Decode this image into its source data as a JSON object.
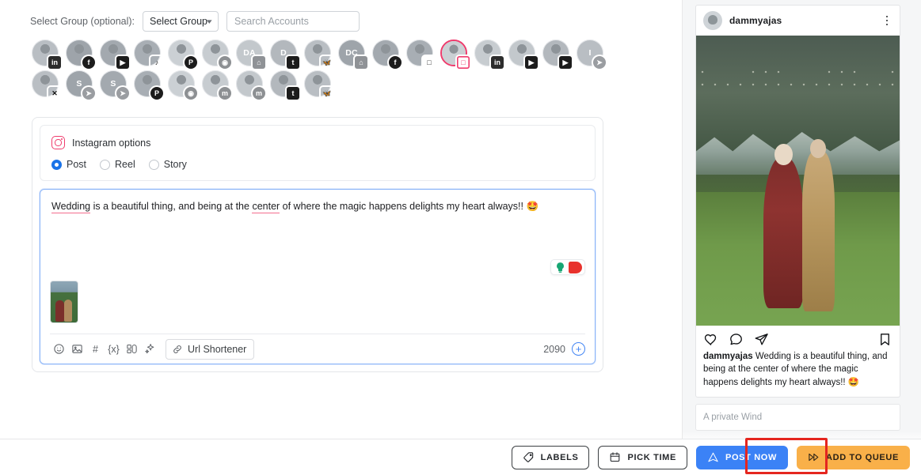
{
  "composer": {
    "group_label": "Select Group (optional):",
    "group_select_value": "Select Group",
    "group_chevron": "chevron-down-icon",
    "search_placeholder": "Search Accounts"
  },
  "accounts": {
    "row1": [
      {
        "initials": "",
        "network": "linkedin",
        "selected": false
      },
      {
        "initials": "",
        "network": "facebook",
        "selected": false
      },
      {
        "initials": "",
        "network": "youtube",
        "selected": false
      },
      {
        "initials": "",
        "network": "tiktok",
        "selected": false
      },
      {
        "initials": "",
        "network": "pinterest",
        "selected": false
      },
      {
        "initials": "",
        "network": "reddit",
        "selected": false
      },
      {
        "initials": "DA",
        "network": "google-business",
        "selected": false
      },
      {
        "initials": "D",
        "network": "tumblr",
        "selected": false
      },
      {
        "initials": "",
        "network": "bluesky",
        "selected": false
      },
      {
        "initials": "DC",
        "network": "google-business",
        "selected": false
      },
      {
        "initials": "",
        "network": "facebook",
        "selected": false
      },
      {
        "initials": "",
        "network": "instagram",
        "selected": false
      },
      {
        "initials": "",
        "network": "instagram",
        "selected": true
      },
      {
        "initials": "",
        "network": "linkedin",
        "selected": false
      },
      {
        "initials": "",
        "network": "youtube",
        "selected": false
      },
      {
        "initials": "",
        "network": "youtube",
        "selected": false
      },
      {
        "initials": "I",
        "network": "telegram",
        "selected": false
      }
    ],
    "row2": [
      {
        "initials": "",
        "network": "x",
        "selected": false
      },
      {
        "initials": "S",
        "network": "telegram",
        "selected": false
      },
      {
        "initials": "S",
        "network": "telegram",
        "selected": false
      },
      {
        "initials": "",
        "network": "pinterest",
        "selected": false
      },
      {
        "initials": "",
        "network": "reddit",
        "selected": false
      },
      {
        "initials": "",
        "network": "mastodon",
        "selected": false
      },
      {
        "initials": "",
        "network": "mastodon",
        "selected": false
      },
      {
        "initials": "",
        "network": "tumblr",
        "selected": false
      },
      {
        "initials": "",
        "network": "bluesky",
        "selected": false
      }
    ]
  },
  "instagram_options": {
    "icon": "instagram-icon",
    "title": "Instagram options",
    "types": [
      {
        "label": "Post",
        "selected": true
      },
      {
        "label": "Reel",
        "selected": false
      },
      {
        "label": "Story",
        "selected": false
      }
    ]
  },
  "editor": {
    "text_parts": [
      {
        "text": "Wedding",
        "spellcheck": true
      },
      {
        "text": " is a beautiful thing, and being at the ",
        "spellcheck": false
      },
      {
        "text": "center",
        "spellcheck": true
      },
      {
        "text": " of where the magic happens delights my heart always!! ",
        "spellcheck": false
      },
      {
        "text": "🤩",
        "spellcheck": false
      }
    ],
    "full_text": "Wedding is a beautiful thing, and being at the center of where the magic happens delights my heart always!! 🤩",
    "tips_badge": {
      "bulb": "lightbulb-icon",
      "bulb_color": "#17a673",
      "blob_color": "#e8312c"
    },
    "attachment_alt": "wedding-couple-thumbnail",
    "toolbar": [
      {
        "name": "emoji-icon",
        "label": ""
      },
      {
        "name": "image-icon",
        "label": ""
      },
      {
        "name": "hashtag-icon",
        "label": "#"
      },
      {
        "name": "variable-icon",
        "label": "{x}"
      },
      {
        "name": "template-icon",
        "label": ""
      },
      {
        "name": "ai-sparkle-icon",
        "label": ""
      }
    ],
    "url_shortener_label": "Url Shortener",
    "url_shortener_icon": "link-icon",
    "char_count": "2090",
    "add_button_icon": "plus-circle-icon"
  },
  "preview": {
    "username": "dammyajas",
    "menu_icon": "kebab-menu-icon",
    "avatar": "user-avatar",
    "image_alt": "wedding-couple-photo",
    "actions": [
      {
        "name": "like-icon"
      },
      {
        "name": "comment-icon"
      },
      {
        "name": "share-icon"
      },
      {
        "name": "bookmark-icon"
      }
    ],
    "caption_user": "dammyajas",
    "caption_text": " Wedding is a beautiful thing, and being at the center of where the magic happens delights my heart always!! 🤩",
    "next_card_text": "A private Wind"
  },
  "footer": {
    "buttons": [
      {
        "label": "LABELS",
        "icon": "tag-icon",
        "style": "ghost",
        "highlighted": false
      },
      {
        "label": "PICK TIME",
        "icon": "calendar-icon",
        "style": "ghost",
        "highlighted": false
      },
      {
        "label": "POST NOW",
        "icon": "send-icon",
        "style": "primary",
        "highlighted": true
      },
      {
        "label": "ADD TO QUEUE",
        "icon": "fast-forward-icon",
        "style": "warn",
        "highlighted": false
      }
    ],
    "highlight_color": "#e5261f",
    "primary_color": "#3b82f6",
    "warn_color": "#f9b049"
  }
}
